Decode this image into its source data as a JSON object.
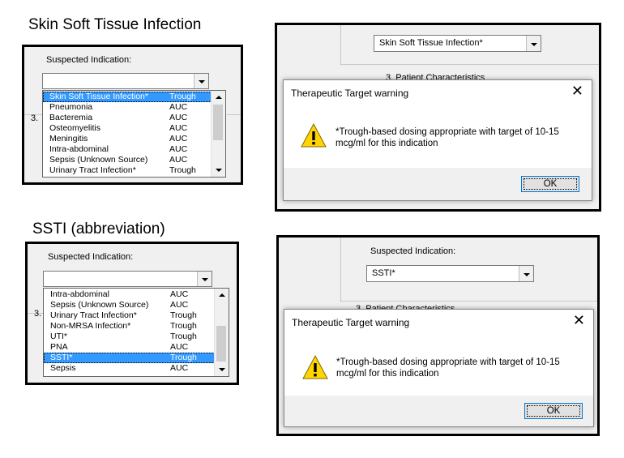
{
  "section1": {
    "title": "Skin Soft Tissue Infection",
    "dropdown_panel": {
      "label": "Suspected Indication:",
      "combo_value": "",
      "behind_number": "3.",
      "options": [
        {
          "name": "Skin Soft Tissue Infection*",
          "method": "Trough",
          "selected": true
        },
        {
          "name": "Pneumonia",
          "method": "AUC"
        },
        {
          "name": "Bacteremia",
          "method": "AUC"
        },
        {
          "name": "Osteomyelitis",
          "method": "AUC"
        },
        {
          "name": "Meningitis",
          "method": "AUC"
        },
        {
          "name": "Intra-abdominal",
          "method": "AUC"
        },
        {
          "name": "Sepsis (Unknown Source)",
          "method": "AUC"
        },
        {
          "name": "Urinary Tract Infection*",
          "method": "Trough"
        }
      ]
    },
    "warning_panel": {
      "combo_value": "Skin Soft Tissue Infection*",
      "behind_text": "3. Patient Characteristics",
      "dialog_title": "Therapeutic Target warning",
      "close_label": "✕",
      "message_line1": "*Trough-based dosing appropriate with target of 10-15",
      "message_line2": "mcg/ml for this indication",
      "ok_label": "OK"
    }
  },
  "section2": {
    "title": "SSTI (abbreviation)",
    "dropdown_panel": {
      "label": "Suspected Indication:",
      "combo_value": "",
      "behind_number": "3.",
      "options": [
        {
          "name": "Intra-abdominal",
          "method": "AUC"
        },
        {
          "name": "Sepsis (Unknown Source)",
          "method": "AUC"
        },
        {
          "name": "Urinary Tract Infection*",
          "method": "Trough"
        },
        {
          "name": "Non-MRSA Infection*",
          "method": "Trough"
        },
        {
          "name": "UTI*",
          "method": "Trough"
        },
        {
          "name": "PNA",
          "method": "AUC"
        },
        {
          "name": "SSTI*",
          "method": "Trough",
          "selected": true
        },
        {
          "name": "Sepsis",
          "method": "AUC"
        }
      ]
    },
    "warning_panel": {
      "label": "Suspected Indication:",
      "combo_value": "SSTI*",
      "behind_text": "3. Patient Characteristics",
      "dialog_title": "Therapeutic Target warning",
      "close_label": "✕",
      "message_line1": "*Trough-based dosing appropriate with target of 10-15",
      "message_line2": "mcg/ml for this indication",
      "ok_label": "OK"
    }
  },
  "colors": {
    "selection": "#3399ff",
    "dialog_footer": "#f0f0f0",
    "warning_yellow": "#ffd400"
  },
  "icons": [
    "chevron-down-icon",
    "warning-triangle-icon",
    "close-icon"
  ]
}
